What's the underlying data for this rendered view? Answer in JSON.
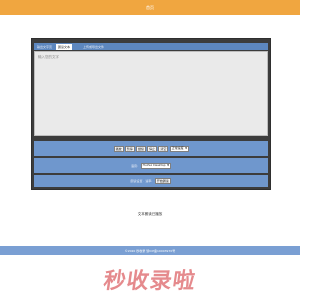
{
  "header": {
    "title": "首页"
  },
  "tabs": [
    {
      "label": "输出文字页",
      "active": false
    },
    {
      "label": "朗读文本",
      "active": true
    },
    {
      "label": "上传或导出文件",
      "active": false
    }
  ],
  "editor": {
    "placeholder": "输入您的文字"
  },
  "controls": {
    "play_label": "播放",
    "pause_label": "暂停",
    "resume_label": "继续",
    "stop_label": "停止",
    "clear_label": "清空",
    "mode_value": "正常速度"
  },
  "voice": {
    "label": "语音:",
    "selected": "Huihui Desktop"
  },
  "speed": {
    "label": "朗读设置 · 速率:",
    "button_label": "开始朗读"
  },
  "status": {
    "text": "文本朗读已播放"
  },
  "footer": {
    "copyright": "©2020 秒收录 浙ICP备19003970号"
  },
  "watermark": {
    "text": "秒收录啦"
  },
  "colors": {
    "top_bar": "#f0a640",
    "panel_bg": "#3c3c3c",
    "row_bg": "#6f97cd",
    "footer_bg": "#7a9fd3",
    "watermark": "#e58a8d"
  }
}
